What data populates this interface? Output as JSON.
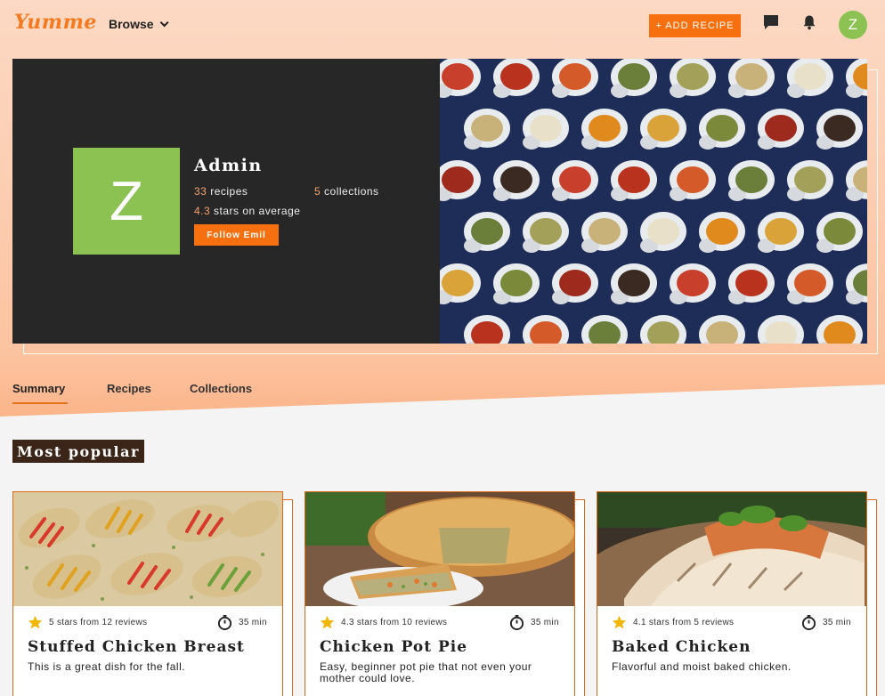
{
  "app": {
    "logo": "Yumme"
  },
  "header": {
    "browse_label": "Browse",
    "add_recipe_label": "+ ADD RECIPE",
    "avatar_initial": "Z",
    "avatar_color": "#8cc251",
    "accent_color": "#f7700f"
  },
  "profile": {
    "initial": "Z",
    "name": "Admin",
    "recipes_count": "33",
    "recipes_label": "recipes",
    "collections_count": "5",
    "collections_label": "collections",
    "avg_stars": "4.3",
    "avg_stars_label": "stars on average",
    "follow_label": "Follow Emil"
  },
  "tabs": [
    {
      "label": "Summary",
      "active": true
    },
    {
      "label": "Recipes",
      "active": false
    },
    {
      "label": "Collections",
      "active": false
    }
  ],
  "section": {
    "title": "Most popular"
  },
  "cards": [
    {
      "title": "Stuffed Chicken Breast",
      "rating_text": "5 stars from 12 reviews",
      "time": "35 min",
      "description": "This is a great dish for the fall."
    },
    {
      "title": "Chicken Pot Pie",
      "rating_text": "4.3 stars from 10 reviews",
      "time": "35 min",
      "description": "Easy, beginner pot pie that not even your mother could love."
    },
    {
      "title": "Baked Chicken",
      "rating_text": "4.1 stars from 5 reviews",
      "time": "35 min",
      "description": "Flavorful and moist baked chicken."
    }
  ]
}
